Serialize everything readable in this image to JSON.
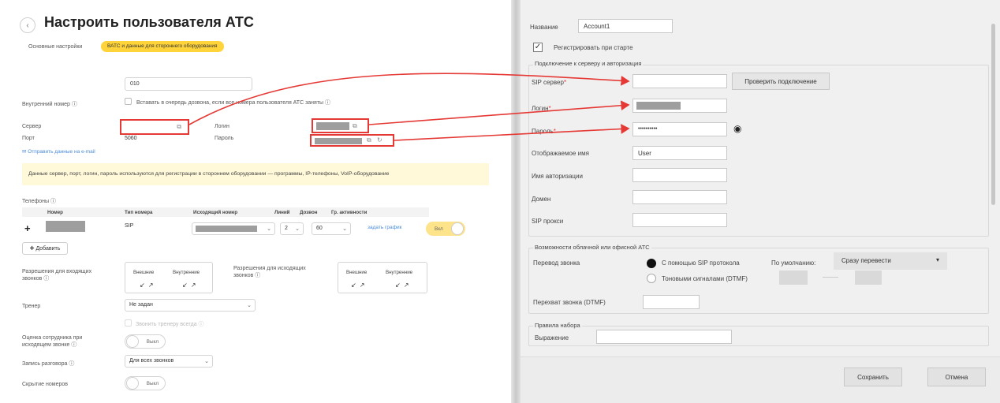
{
  "left": {
    "title": "Настроить пользователя АТС",
    "tabs": [
      "Основные настройки",
      "ВАТС и данные для стороннего оборудования"
    ],
    "internal_number_label": "Внутренний номер ⓘ",
    "internal_number_value": "010",
    "queue_checkbox_label": "Вставать в очередь дозвона, если все номера пользователя АТС заняты ⓘ",
    "server_label": "Сервер",
    "port_label": "Порт",
    "port_value": "5060",
    "login_label": "Логин",
    "password_label": "Пароль",
    "send_email_link": "Отправить данные на e-mail",
    "notice": "Данные сервер, порт, логин, пароль используются для регистрации в стороннем оборудовании — программы, IP-телефоны, VoIP-оборудование",
    "phones_label": "Телефоны ⓘ",
    "phones_table": {
      "headers": [
        "Номер",
        "Тип номера",
        "Исходящий номер",
        "Линий",
        "Дозвон",
        "Гр. активности"
      ],
      "row": {
        "type": "SIP",
        "lines": "2",
        "dial": "60",
        "schedule_link": "задать график",
        "toggle": "Вкл"
      }
    },
    "add_button": "Добавить",
    "incoming_perm_label": "Разрешения для входящих звонков ⓘ",
    "outgoing_perm_label": "Разрешения для исходящих звонков ⓘ",
    "perm_headers": [
      "Внешние",
      "Внутренние"
    ],
    "perm_arrows": "↙ ↗",
    "trainer_label": "Тренер",
    "trainer_value": "Не задан",
    "trainer_call_label": "Звонить тренеру всегда ⓘ",
    "rating_label": "Оценка сотрудника при исходящем звонке ⓘ",
    "rating_toggle": "Выкл",
    "recording_label": "Запись разговора ⓘ",
    "recording_value": "Для всех звонков",
    "hide_numbers_label": "Скрытие номеров",
    "hide_numbers_toggle": "Выкл"
  },
  "right": {
    "name_label": "Название",
    "name_value": "Account1",
    "register_label": "Регистрировать при старте",
    "conn_group_title": "Подключение к серверу и авторизация",
    "sip_server_label": "SIP сервер",
    "check_button": "Проверить подключение",
    "login_label": "Логин",
    "password_label": "Пароль",
    "password_value": "••••••••••",
    "display_name_label": "Отображаемое имя",
    "display_name_value": "User",
    "auth_name_label": "Имя авторизации",
    "domain_label": "Домен",
    "sip_proxy_label": "SIP прокси",
    "cloud_group_title": "Возможности облачной или офисной АТС",
    "transfer_label": "Перевод звонка",
    "radio_sip": "С помощью SIP протокола",
    "radio_dtmf": "Тоновыми сигналами (DTMF)",
    "default_label": "По умолчанию:",
    "default_value": "Сразу перевести",
    "intercept_label": "Перехват звонка (DTMF)",
    "dial_rules_title": "Правила набора",
    "expression_label": "Выражение",
    "save_button": "Сохранить",
    "cancel_button": "Отмена"
  }
}
